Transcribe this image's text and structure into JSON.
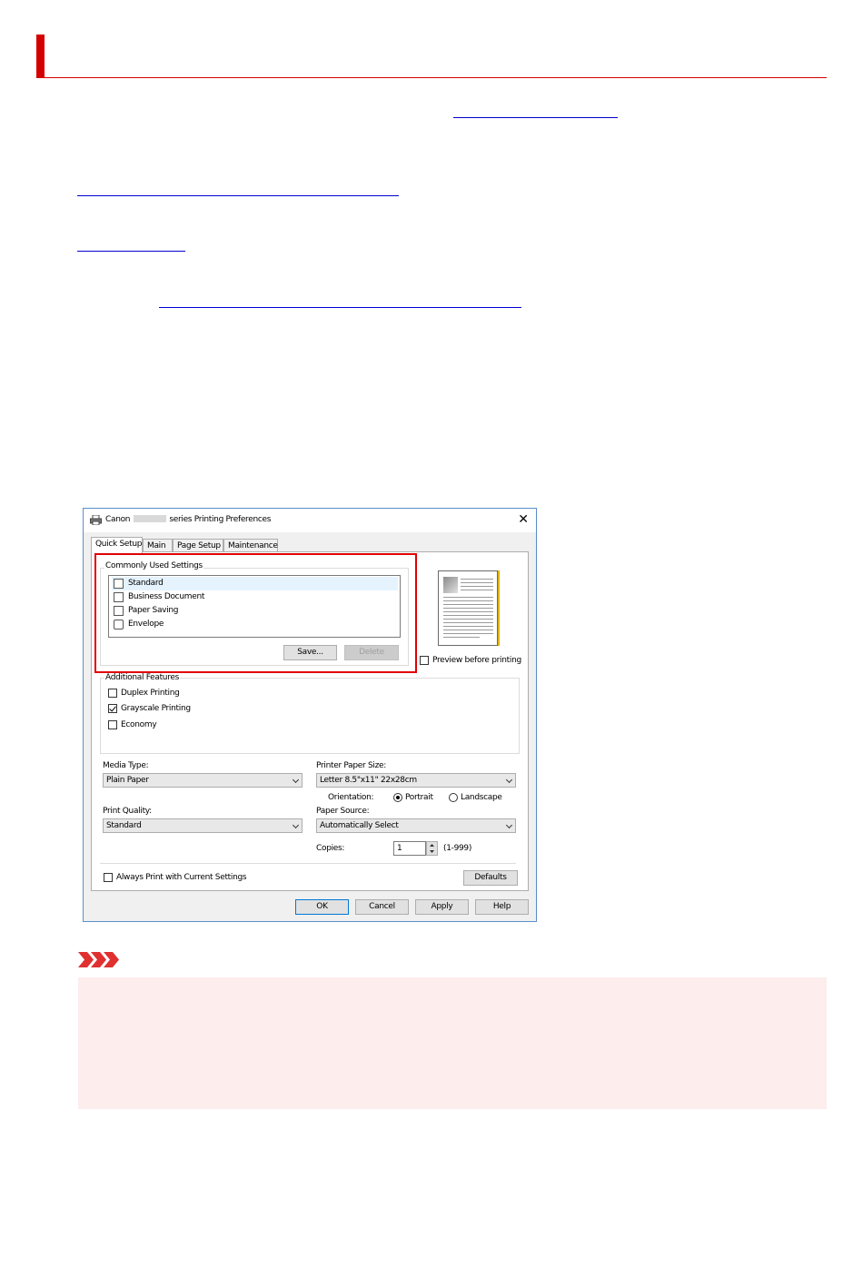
{
  "dialog": {
    "title_prefix": "Canon",
    "title_suffix": "series Printing Preferences",
    "close_symbol": "✕",
    "tabs": [
      {
        "label": "Quick Setup"
      },
      {
        "label": "Main"
      },
      {
        "label": "Page Setup"
      },
      {
        "label": "Maintenance"
      }
    ],
    "commonly_used": {
      "label": "Commonly Used Settings",
      "items": [
        {
          "label": "Standard",
          "icon": "standard-doc-icon"
        },
        {
          "label": "Business Document",
          "icon": "business-doc-icon"
        },
        {
          "label": "Paper Saving",
          "icon": "paper-saving-icon"
        },
        {
          "label": "Envelope",
          "icon": "envelope-icon"
        }
      ],
      "save_label": "Save...",
      "delete_label": "Delete"
    },
    "preview_label": "Preview before printing",
    "additional": {
      "label": "Additional Features",
      "duplex": "Duplex Printing",
      "grayscale": "Grayscale Printing",
      "economy": "Economy"
    },
    "media_type": {
      "label": "Media Type:",
      "value": "Plain Paper"
    },
    "paper_size": {
      "label": "Printer Paper Size:",
      "value": "Letter 8.5\"x11\" 22x28cm"
    },
    "orientation": {
      "label": "Orientation:",
      "portrait": "Portrait",
      "landscape": "Landscape"
    },
    "print_quality": {
      "label": "Print Quality:",
      "value": "Standard"
    },
    "paper_source": {
      "label": "Paper Source:",
      "value": "Automatically Select"
    },
    "copies": {
      "label": "Copies:",
      "value": "1",
      "range": "(1-999)"
    },
    "always_print": "Always Print with Current Settings",
    "defaults_label": "Defaults",
    "footer": {
      "ok": "OK",
      "cancel": "Cancel",
      "apply": "Apply",
      "help": "Help"
    }
  },
  "colors": {
    "accent_red": "#d40000",
    "link_blue": "#0000d0",
    "notice_bg": "#fdeded"
  }
}
